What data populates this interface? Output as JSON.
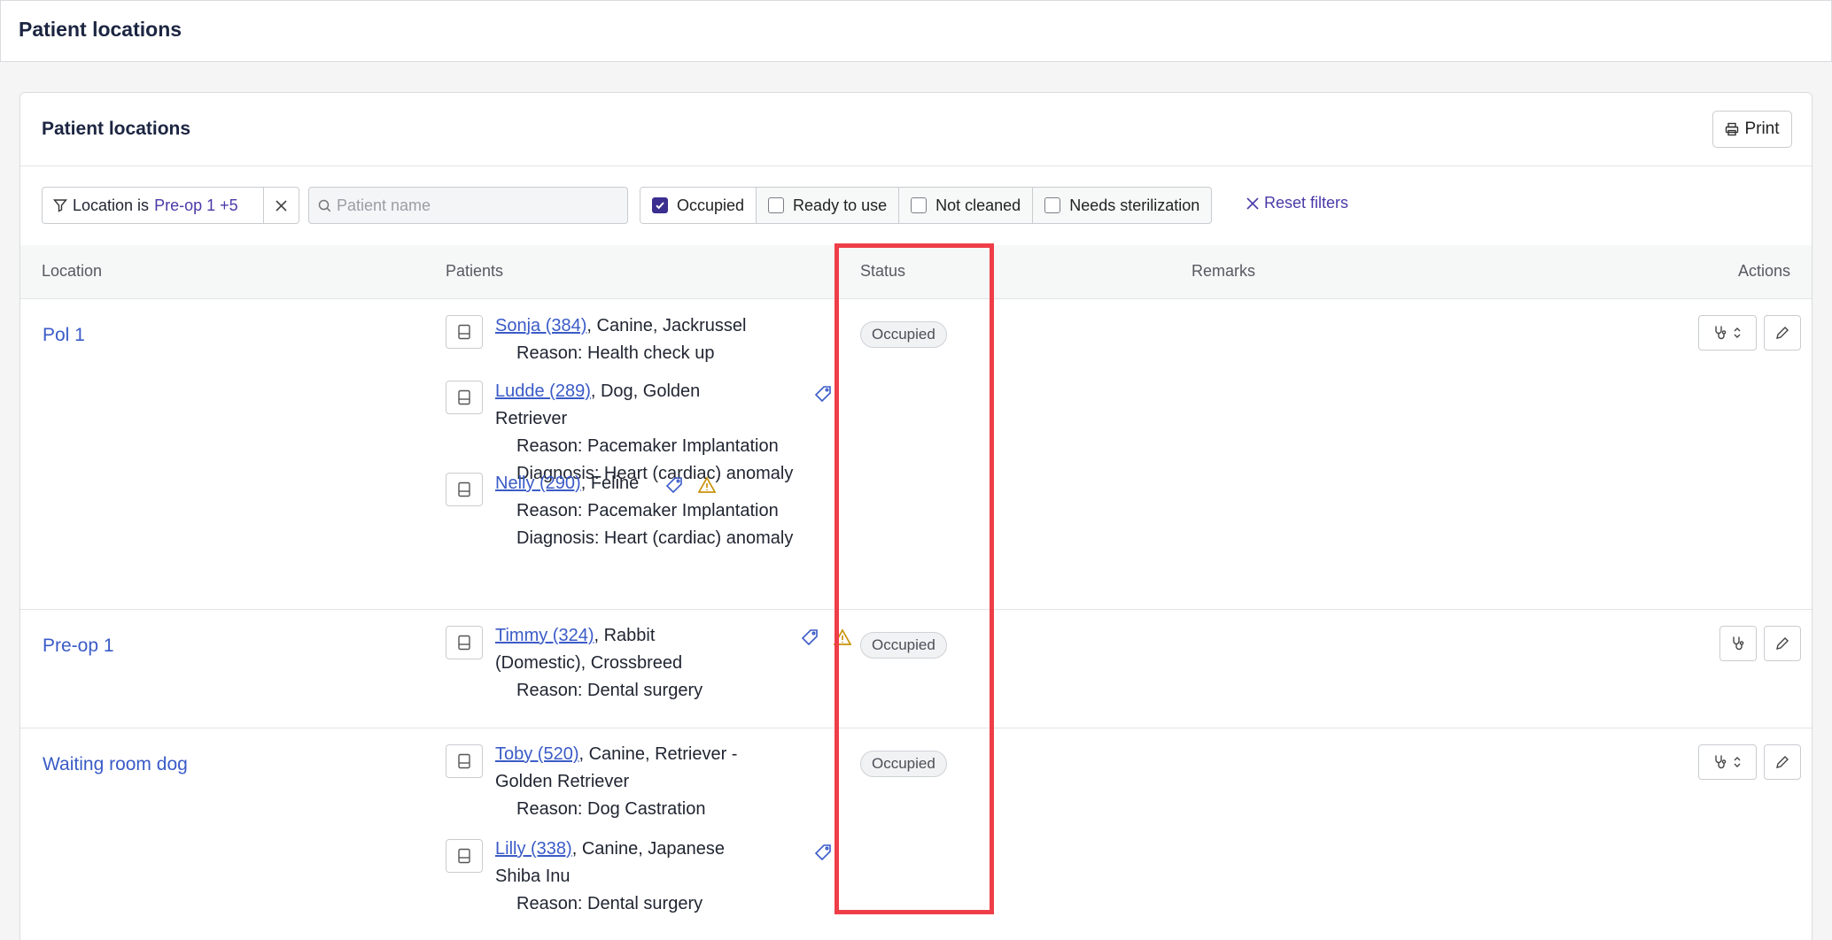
{
  "page": {
    "title": "Patient locations"
  },
  "card": {
    "title": "Patient locations",
    "print_label": "Print"
  },
  "filters": {
    "location_chip": {
      "prefix": "Location is",
      "value": "Pre-op 1 +5"
    },
    "search": {
      "placeholder": "Patient name",
      "value": ""
    },
    "statuses": [
      {
        "label": "Occupied",
        "checked": true
      },
      {
        "label": "Ready to use",
        "checked": false
      },
      {
        "label": "Not cleaned",
        "checked": false
      },
      {
        "label": "Needs sterilization",
        "checked": false
      }
    ],
    "reset_label": "Reset filters"
  },
  "table": {
    "columns": [
      "Location",
      "Patients",
      "Status",
      "Remarks",
      "Actions"
    ],
    "rows": [
      {
        "location": "Pol 1",
        "status": "Occupied",
        "patients": [
          {
            "name": "Sonja (384)",
            "rest": ", Canine, Jackrussel",
            "reason": "Reason: Health check up"
          },
          {
            "name": "Ludde (289)",
            "rest": ", Dog, Golden",
            "rest2": "Retriever",
            "reason": "Reason: Pacemaker Implantation",
            "diagnosis": "Diagnosis: Heart (cardiac) anomaly"
          },
          {
            "name": "Nelly (290)",
            "rest": ", Feline",
            "reason": "Reason: Pacemaker Implantation",
            "diagnosis": "Diagnosis: Heart (cardiac) anomaly"
          }
        ]
      },
      {
        "location": "Pre-op 1",
        "status": "Occupied",
        "patients": [
          {
            "name": "Timmy (324)",
            "rest": ", Rabbit",
            "rest2": "(Domestic), Crossbreed",
            "reason": "Reason: Dental surgery"
          }
        ]
      },
      {
        "location": "Waiting room dog",
        "status": "Occupied",
        "patients": [
          {
            "name": "Toby (520)",
            "rest": ", Canine, Retriever -",
            "rest2": "Golden Retriever",
            "reason": "Reason: Dog Castration"
          },
          {
            "name": "Lilly (338)",
            "rest": ", Canine, Japanese",
            "rest2": "Shiba Inu",
            "reason": "Reason: Dental surgery"
          }
        ]
      }
    ]
  },
  "colors": {
    "accent": "#4a3aa8",
    "link": "#3a5bc7",
    "highlight": "#ee3e48",
    "warning": "#c9920a"
  }
}
